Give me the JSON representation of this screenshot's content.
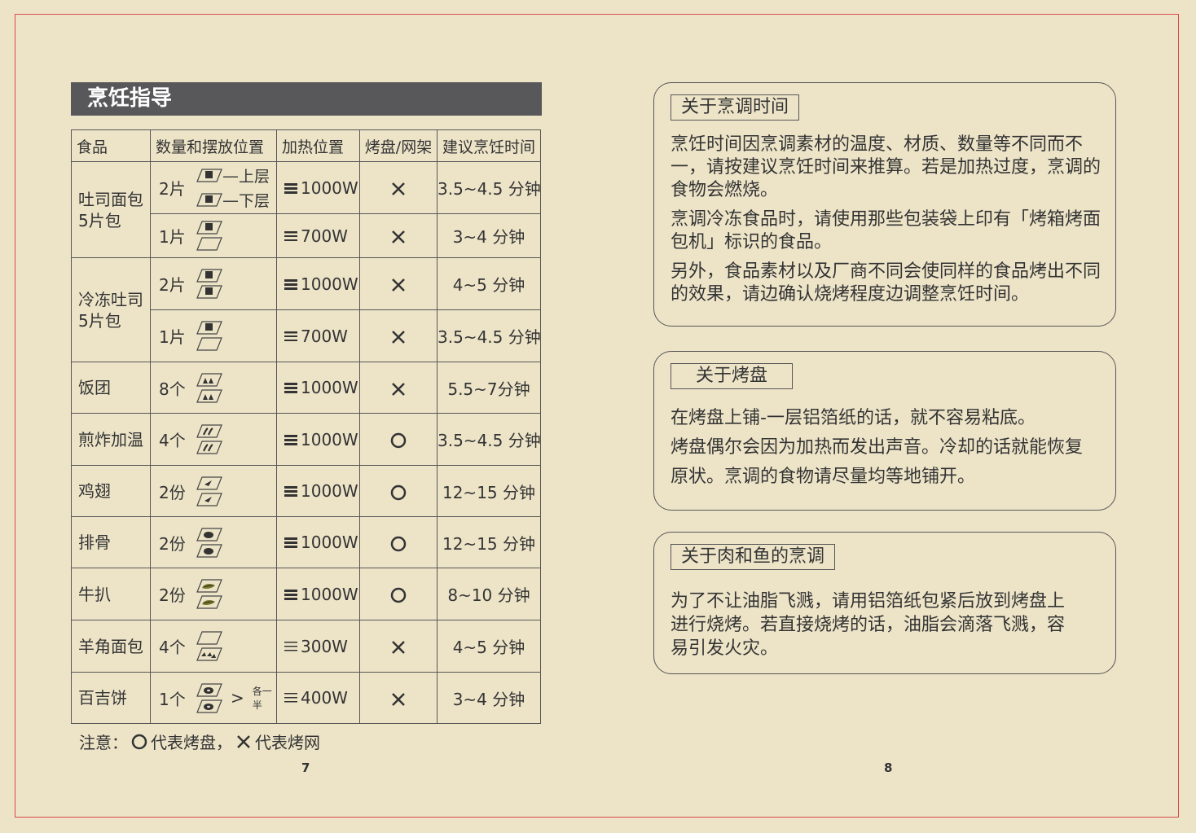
{
  "left_page": {
    "section_title": "烹饪指导",
    "table": {
      "headers": [
        "食品",
        "数量和摆放位置",
        "加热位置",
        "烤盘/网架",
        "建议烹饪时间"
      ],
      "rows": [
        {
          "food": "吐司面包\n5片包",
          "qty": "2片",
          "trays": [
            "bread",
            "bread"
          ],
          "tray_labels": [
            "上层",
            "下层"
          ],
          "heat": "1000W",
          "heat_icon": "heat-both-icon",
          "rack": "x",
          "time": "3.5~4.5 分钟"
        },
        {
          "food": "",
          "qty": "1片",
          "trays": [
            "bread",
            "empty"
          ],
          "heat": "700W",
          "heat_icon": "heat-top-icon",
          "rack": "x",
          "time": "3~4 分钟"
        },
        {
          "food": "冷冻吐司\n5片包",
          "qty": "2片",
          "trays": [
            "bread",
            "bread"
          ],
          "heat": "1000W",
          "heat_icon": "heat-both-icon",
          "rack": "x",
          "time": "4~5 分钟"
        },
        {
          "food": "",
          "qty": "1片",
          "trays": [
            "bread",
            "empty"
          ],
          "heat": "700W",
          "heat_icon": "heat-top-icon",
          "rack": "x",
          "time": "3.5~4.5 分钟"
        },
        {
          "food": "饭团",
          "qty": "8个",
          "trays": [
            "riceball",
            "riceball"
          ],
          "heat": "1000W",
          "heat_icon": "heat-both-icon",
          "rack": "x",
          "time": "5.5~7分钟"
        },
        {
          "food": "煎炸加温",
          "qty": "4个",
          "trays": [
            "fried",
            "fried"
          ],
          "heat": "1000W",
          "heat_icon": "heat-both-icon",
          "rack": "o",
          "time": "3.5~4.5 分钟"
        },
        {
          "food": "鸡翅",
          "qty": "2份",
          "trays": [
            "wing",
            "wing"
          ],
          "heat": "1000W",
          "heat_icon": "heat-both-icon",
          "rack": "o",
          "time": "12~15 分钟"
        },
        {
          "food": "排骨",
          "qty": "2份",
          "trays": [
            "rib",
            "rib"
          ],
          "heat": "1000W",
          "heat_icon": "heat-both-icon",
          "rack": "o",
          "time": "12~15 分钟"
        },
        {
          "food": "牛扒",
          "qty": "2份",
          "trays": [
            "steak",
            "steak"
          ],
          "heat": "1000W",
          "heat_icon": "heat-both-icon",
          "rack": "o",
          "time": "8~10 分钟"
        },
        {
          "food": "羊角面包",
          "qty": "4个",
          "trays": [
            "empty",
            "croissant"
          ],
          "heat": "300W",
          "heat_icon": "heat-low-icon",
          "rack": "x",
          "time": "4~5 分钟"
        },
        {
          "food": "百吉饼",
          "qty": "1个",
          "trays": [
            "bagel",
            "bagel"
          ],
          "tray_brace": "各一半",
          "heat": "400W",
          "heat_icon": "heat-low-icon",
          "rack": "x",
          "time": "3~4 分钟"
        }
      ]
    },
    "legend": {
      "prefix": "注意：",
      "o_text": "代表烤盘，",
      "x_text": "代表烤网"
    },
    "page_number": "7"
  },
  "right_page": {
    "boxes": [
      {
        "title": "关于烹调时间",
        "paragraphs": [
          "烹饪时间因烹调素材的温度、材质、数量等不同而不一，请按建议烹饪时间来推算。若是加热过度，烹调的食物会燃烧。",
          "烹调冷冻食品时，请使用那些包装袋上印有「烤箱烤面包机」标识的食品。",
          "另外，食品素材以及厂商不同会使同样的食品烤出不同的效果，请边确认烧烤程度边调整烹饪时间。"
        ]
      },
      {
        "title": "关于烤盘",
        "paragraphs": [
          "在烤盘上铺-一层铝箔纸的话，就不容易粘底。",
          "烤盘偶尔会因为加热而发出声音。冷却的话就能恢复原状。烹调的食物请尽量均等地铺开。"
        ]
      },
      {
        "title": "关于肉和鱼的烹调",
        "paragraphs": [
          "为了不让油脂飞溅，请用铝箔纸包紧后放到烤盘上进行烧烤。若直接烧烤的话，油脂会滴落飞溅，容易引发火灾。"
        ]
      }
    ],
    "page_number": "8"
  }
}
